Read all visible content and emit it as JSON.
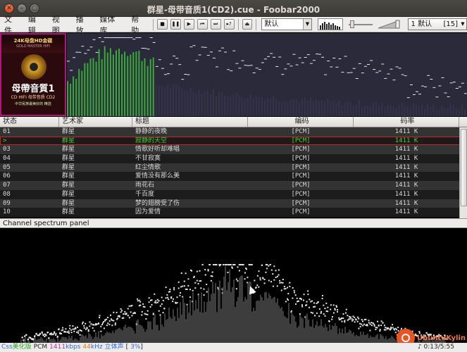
{
  "window": {
    "title": "群星-母带音质1(CD2).cue - Foobar2000",
    "buttons": [
      "✕",
      "–",
      "▢"
    ]
  },
  "menu": [
    "文件",
    "编辑",
    "视图",
    "播放",
    "媒体库",
    "帮助"
  ],
  "toolbar": {
    "transport_icons": [
      "stop-icon",
      "pause-icon",
      "play-icon",
      "previous-icon",
      "next-icon",
      "random-icon",
      "eject-icon"
    ],
    "transport_glyphs": [
      "■",
      "❚❚",
      "▶",
      "⏮",
      "⏭",
      "▸?",
      "⏏"
    ],
    "order_select": "默认",
    "playlist_selector": {
      "label": "1 默认",
      "count": "[15]"
    }
  },
  "album_art": {
    "top": "24K母盘HD金碟",
    "sub": "GOLD MASTER HIFI",
    "title": "母帶音質1",
    "line": "CD HIFI 母带音质 CD2",
    "tiny": "中华民族最美好的 精选"
  },
  "playlist": {
    "columns": [
      "状态",
      "艺术家",
      "标题",
      "编码",
      "码率"
    ],
    "rows": [
      {
        "status": "01",
        "artist": "群星",
        "title": "静静的夜晚",
        "codec": "[PCM]",
        "bitrate": "1411 K"
      },
      {
        "status": ">",
        "artist": "群星",
        "title": "寂静的天空",
        "codec": "[PCM]",
        "bitrate": "1411 K",
        "playing": true
      },
      {
        "status": "03",
        "artist": "群星",
        "title": "情歌好听却难唱",
        "codec": "[PCM]",
        "bitrate": "1411 K"
      },
      {
        "status": "04",
        "artist": "群星",
        "title": "不甘寂寞",
        "codec": "[PCM]",
        "bitrate": "1411 K"
      },
      {
        "status": "05",
        "artist": "群星",
        "title": "红尘情歌",
        "codec": "[PCM]",
        "bitrate": "1411 K"
      },
      {
        "status": "06",
        "artist": "群星",
        "title": "爱情没有那么美",
        "codec": "[PCM]",
        "bitrate": "1411 K"
      },
      {
        "status": "07",
        "artist": "群星",
        "title": "雨花石",
        "codec": "[PCM]",
        "bitrate": "1411 K"
      },
      {
        "status": "08",
        "artist": "群星",
        "title": "千百度",
        "codec": "[PCM]",
        "bitrate": "1411 K"
      },
      {
        "status": "09",
        "artist": "群星",
        "title": "梦的翅膀受了伤",
        "codec": "[PCM]",
        "bitrate": "1411 K"
      },
      {
        "status": "10",
        "artist": "群星",
        "title": "因为爱情",
        "codec": "[PCM]",
        "bitrate": "1411 K"
      }
    ]
  },
  "panel_caption": "Channel spectrum panel",
  "status": {
    "parts": [
      {
        "text": "Css",
        "color": "#2b6cd6"
      },
      {
        "text": "美化版",
        "color": "#2aa52a"
      },
      {
        "text": "PCM",
        "color": "#222222"
      },
      {
        "text": "1411",
        "color": "#c0309a"
      },
      {
        "text": "kbps",
        "color": "#2b6cd6"
      },
      {
        "text": "44",
        "color": "#e07a1a"
      },
      {
        "text": "kHz",
        "color": "#2b6cd6"
      },
      {
        "text": "立体声",
        "color": "#2b6cd6"
      },
      {
        "text": "[",
        "color": "#222222"
      },
      {
        "text": "3%",
        "color": "#2b6cd6"
      },
      {
        "text": "]",
        "color": "#222222"
      }
    ],
    "time": "0:13/5:55"
  },
  "watermark": "UbuntuKylin",
  "colors": {
    "accent_playing": "#37d437",
    "playing_border": "#d02020",
    "vis_bg": "#2b2a3b",
    "vis_bar": "#3aa83a",
    "vis_peak": "#e8e8e8"
  }
}
